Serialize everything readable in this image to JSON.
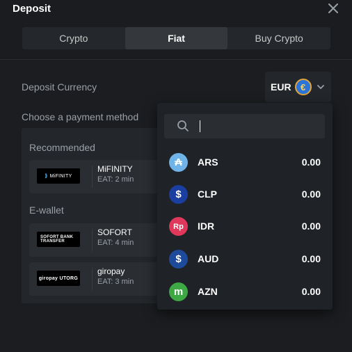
{
  "dialog": {
    "title": "Deposit",
    "tabs": [
      {
        "label": "Crypto"
      },
      {
        "label": "Fiat"
      },
      {
        "label": "Buy Crypto"
      }
    ],
    "active_tab": "Fiat"
  },
  "deposit_currency": {
    "label": "Deposit Currency",
    "selected": "EUR",
    "coin_symbol": "€",
    "coin_color": "#2d74d8"
  },
  "payment": {
    "label": "Choose a payment method",
    "recommended_title": "Recommended",
    "ewallet_title": "E-wallet",
    "methods": [
      {
        "name": "MiFINITY",
        "eat": "EAT: 2 min",
        "logo_text": "MiFINITY"
      },
      {
        "name": "SOFORT",
        "eat": "EAT: 4 min",
        "logo_text": "SOFORT BANK TRANSFER"
      },
      {
        "name": "giropay",
        "eat": "EAT: 3 min",
        "logo_text": "giropay UTORG"
      }
    ]
  },
  "dropdown": {
    "search_value": "",
    "currencies": [
      {
        "code": "ARS",
        "amount": "0.00",
        "symbol": "₳",
        "color": "#6fb3e8"
      },
      {
        "code": "CLP",
        "amount": "0.00",
        "symbol": "$",
        "color": "#1b3fa0"
      },
      {
        "code": "IDR",
        "amount": "0.00",
        "symbol": "Rp",
        "color": "#e0385a"
      },
      {
        "code": "AUD",
        "amount": "0.00",
        "symbol": "$",
        "color": "#1e4a9c"
      },
      {
        "code": "AZN",
        "amount": "0.00",
        "symbol": "m",
        "color": "#3ea845"
      }
    ]
  }
}
